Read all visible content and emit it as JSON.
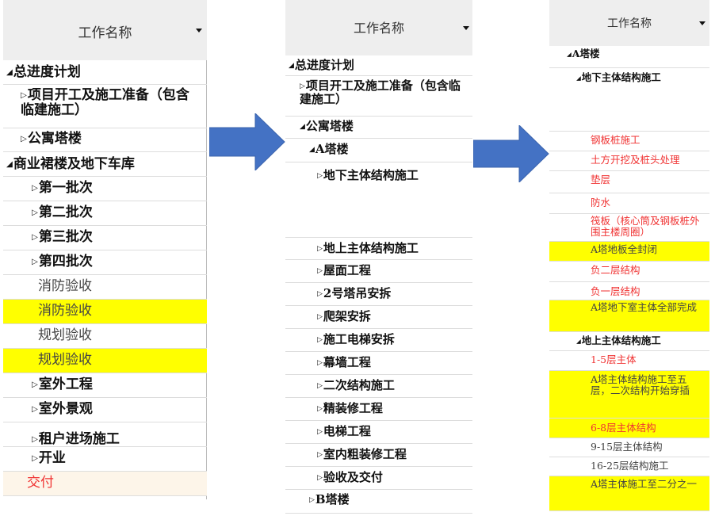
{
  "panels": [
    {
      "header": "工作名称",
      "rows": [
        {
          "text": "总进度计划",
          "marker": "expanded"
        },
        {
          "text": "项目开工及施工准备（包含临建施工）",
          "marker": "collapsed"
        },
        {
          "text": "公寓塔楼",
          "marker": "collapsed"
        },
        {
          "text": "商业裙楼及地下车库",
          "marker": "expanded"
        },
        {
          "text": "第一批次",
          "marker": "collapsed"
        },
        {
          "text": "第二批次",
          "marker": "collapsed"
        },
        {
          "text": "第三批次",
          "marker": "collapsed"
        },
        {
          "text": "第四批次",
          "marker": "collapsed"
        },
        {
          "text": "消防验收",
          "marker": "none"
        },
        {
          "text": "消防验收",
          "marker": "none",
          "highlight": "#ffff00"
        },
        {
          "text": "规划验收",
          "marker": "none"
        },
        {
          "text": "规划验收",
          "marker": "none",
          "highlight": "#ffff00"
        },
        {
          "text": "室外工程",
          "marker": "collapsed"
        },
        {
          "text": "室外景观",
          "marker": "collapsed"
        },
        {
          "text": "租户进场施工",
          "marker": "collapsed"
        },
        {
          "text": "开业",
          "marker": "collapsed"
        },
        {
          "text": "交付",
          "marker": "none",
          "color": "#f03333"
        }
      ]
    },
    {
      "header": "工作名称",
      "rows": [
        {
          "text": "总进度计划",
          "marker": "expanded"
        },
        {
          "text": "项目开工及施工准备（包含临建施工）",
          "marker": "collapsed"
        },
        {
          "text": "公寓塔楼",
          "marker": "expanded"
        },
        {
          "text": "A塔楼",
          "marker": "expanded"
        },
        {
          "text": "地下主体结构施工",
          "marker": "collapsed"
        },
        {
          "text": "地上主体结构施工",
          "marker": "collapsed"
        },
        {
          "text": "屋面工程",
          "marker": "collapsed"
        },
        {
          "text": "2号塔吊安拆",
          "marker": "collapsed"
        },
        {
          "text": "爬架安拆",
          "marker": "collapsed"
        },
        {
          "text": "施工电梯安拆",
          "marker": "collapsed"
        },
        {
          "text": "幕墙工程",
          "marker": "collapsed"
        },
        {
          "text": "二次结构施工",
          "marker": "collapsed"
        },
        {
          "text": "精装修工程",
          "marker": "collapsed"
        },
        {
          "text": "电梯工程",
          "marker": "collapsed"
        },
        {
          "text": "室内粗装修工程",
          "marker": "collapsed"
        },
        {
          "text": "验收及交付",
          "marker": "collapsed"
        },
        {
          "text": "B塔楼",
          "marker": "collapsed"
        }
      ]
    },
    {
      "header": "工作名称",
      "rows": [
        {
          "text": "A塔楼",
          "marker": "expanded"
        },
        {
          "text": "地下主体结构施工",
          "marker": "expanded"
        },
        {
          "text": "钢板桩施工",
          "marker": "none",
          "color": "#f03333"
        },
        {
          "text": "土方开挖及桩头处理",
          "marker": "none",
          "color": "#f03333"
        },
        {
          "text": "垫层",
          "marker": "none",
          "color": "#f03333"
        },
        {
          "text": "防水",
          "marker": "none",
          "color": "#f03333"
        },
        {
          "text": "筏板（核心筒及钢板桩外围主楼周圈）",
          "marker": "none",
          "color": "#f03333"
        },
        {
          "text": "A塔地板全封闭",
          "marker": "none",
          "highlight": "#ffff00"
        },
        {
          "text": "负二层结构",
          "marker": "none",
          "color": "#f03333"
        },
        {
          "text": "负一层结构",
          "marker": "none",
          "color": "#f03333"
        },
        {
          "text": "A塔地下室主体全部完成",
          "marker": "none",
          "highlight": "#ffff00"
        },
        {
          "text": "地上主体结构施工",
          "marker": "expanded"
        },
        {
          "text": "1-5层主体",
          "marker": "none",
          "color": "#f03333"
        },
        {
          "text": "A塔主体结构施工至五层，二次结构开始穿插",
          "marker": "none",
          "highlight": "#ffff00"
        },
        {
          "text": "6-8层主体结构",
          "marker": "none",
          "color": "#f03333",
          "highlight": "#ffff00"
        },
        {
          "text": "9-15层主体结构",
          "marker": "none"
        },
        {
          "text": "16-25层结构施工",
          "marker": "none"
        },
        {
          "text": "A塔主体施工至二分之一",
          "marker": "none",
          "highlight": "#ffff00"
        }
      ]
    }
  ],
  "markers": {
    "expanded": "◢",
    "collapsed": "▷"
  },
  "colors": {
    "arrow_fill": "#4472c4",
    "arrow_stroke": "#3a63ad",
    "header_bg": "#eeeeee",
    "highlight": "#ffff00"
  }
}
